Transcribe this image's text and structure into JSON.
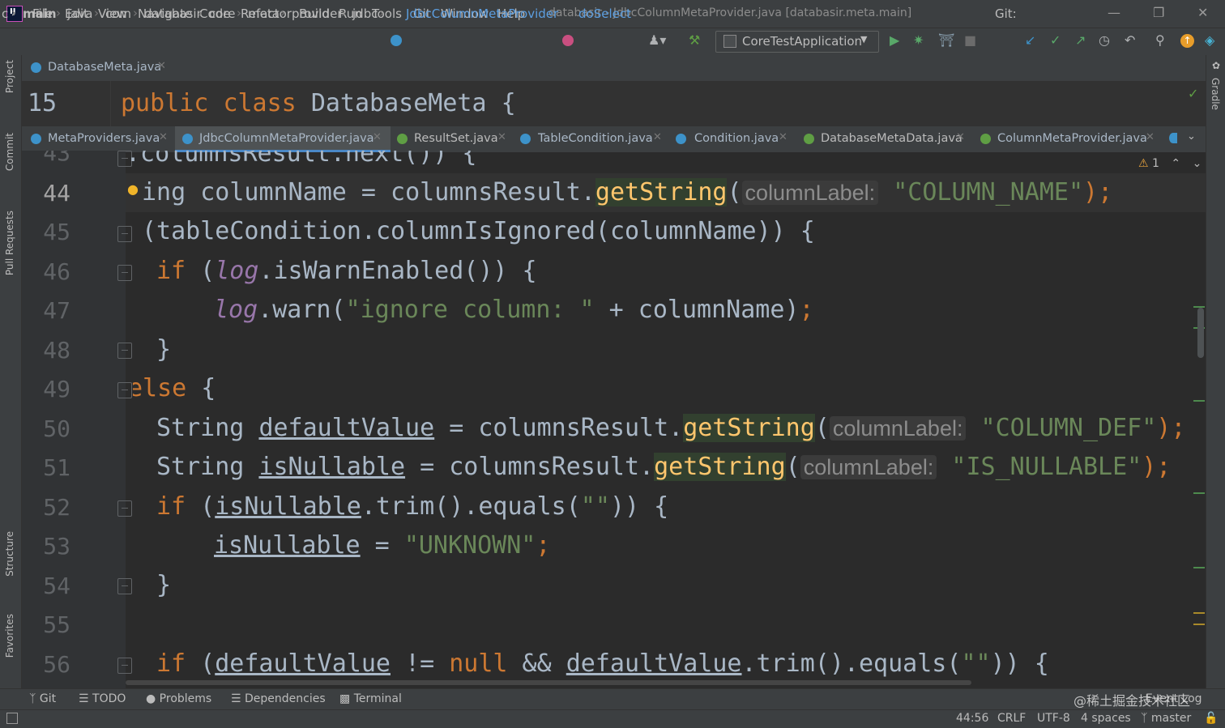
{
  "menu": [
    "File",
    "Edit",
    "View",
    "Navigate",
    "Code",
    "Refactor",
    "Build",
    "Run",
    "Tools",
    "Git",
    "Window",
    "Help"
  ],
  "window_title": "databasir - JdbcColumnMetaProvider.java [databasir.meta.main]",
  "breadcrumb": {
    "lead": "c",
    "items": [
      "main",
      "java",
      "com",
      "databasir",
      "core",
      "meta",
      "provider",
      "jdbc"
    ],
    "class_name": "JdbcColumnMetaProvider",
    "method_name": "doSelect"
  },
  "run_config": "CoreTestApplication",
  "git_label": "Git:",
  "left_tools": [
    "Project",
    "Commit",
    "Pull Requests",
    "Structure",
    "Favorites"
  ],
  "right_tools": [
    "Gradle"
  ],
  "top_tab": "DatabaseMeta.java",
  "sticky": {
    "line": "15",
    "kw1": "public",
    "kw2": "class",
    "name": "DatabaseMeta {"
  },
  "tabs": [
    "MetaProviders.java",
    "JdbcColumnMetaProvider.java",
    "ResultSet.java",
    "TableCondition.java",
    "Condition.java",
    "DatabaseMetaData.java",
    "ColumnMetaProvider.java"
  ],
  "warning_count": "1",
  "code": {
    "l43": "43",
    "l43_text": ".columnsResult.next()) {",
    "l44": "44",
    "l44_a": "ing columnName = columnsResult.",
    "l44_m": "getString",
    "l44_p": "(",
    "l44_hint": "columnLabel:",
    "l44_s": "\"COLUMN_NAME\"",
    "l44_e": ");",
    "l45": "45",
    "l45_text": "(tableCondition.columnIsIgnored(columnName)) {",
    "l46": "46",
    "l46_kw": "if",
    "l46_a": " (",
    "l46_f": "log",
    "l46_b": ".isWarnEnabled()) {",
    "l47": "47",
    "l47_f": "log",
    "l47_a": ".warn(",
    "l47_s": "\"ignore column: \"",
    "l47_b": " + columnName)",
    "l47_e": ";",
    "l48": "48",
    "l48_text": "}",
    "l49": "49",
    "l49_kw": "else",
    "l49_b": " {",
    "l50": "50",
    "l50_t": "String ",
    "l50_v": "defaultValue",
    "l50_a": " = columnsResult.",
    "l50_m": "getString",
    "l50_p": "(",
    "l50_hint": "columnLabel:",
    "l50_s": "\"COLUMN_DEF\"",
    "l50_e": ");",
    "l51": "51",
    "l51_t": "String ",
    "l51_v": "isNullable",
    "l51_a": " = columnsResult.",
    "l51_m": "getString",
    "l51_p": "(",
    "l51_hint": "columnLabel:",
    "l51_s": "\"IS_NULLABLE\"",
    "l51_e": ");",
    "l52": "52",
    "l52_kw": "if",
    "l52_a": " (",
    "l52_v": "isNullable",
    "l52_b": ".trim().equals(",
    "l52_s": "\"\"",
    "l52_c": ")) {",
    "l53": "53",
    "l53_v": "isNullable",
    "l53_a": " = ",
    "l53_s": "\"UNKNOWN\"",
    "l53_e": ";",
    "l54": "54",
    "l54_text": "}",
    "l55": "55",
    "l56": "56",
    "l56_kw": "if",
    "l56_a": " (",
    "l56_v": "defaultValue",
    "l56_b": " != ",
    "l56_null": "null",
    "l56_c": " && ",
    "l56_v2": "defaultValue",
    "l56_d": ".trim().equals(",
    "l56_s": "\"\"",
    "l56_e": ")) {"
  },
  "bottom_tools": [
    "Git",
    "TODO",
    "Problems",
    "Dependencies",
    "Terminal"
  ],
  "event_log": "Event Log",
  "watermark": "@稀土掘金技术社区",
  "status": {
    "position": "44:56",
    "line_sep": "CRLF",
    "encoding": "UTF-8",
    "indent": "4 spaces",
    "branch": "master"
  }
}
